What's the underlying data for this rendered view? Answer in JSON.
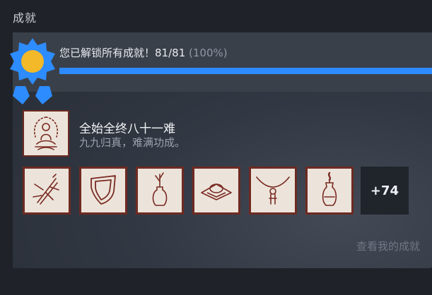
{
  "section": {
    "title": "成就"
  },
  "summary": {
    "message": "您已解锁所有成就！",
    "count": "81/81",
    "percent": "(100%)",
    "progress": 1.0,
    "progress_color": "#2e8bff"
  },
  "featured": {
    "title": "全始全终八十一难",
    "description": "九九归真，难满功成。",
    "icon": "monk-meditating-icon"
  },
  "achievement_icons": [
    "staff-burst-icon",
    "shield-icon",
    "vase-with-branch-icon",
    "ring-necklace-icon",
    "pendant-necklace-icon",
    "vase-with-flame-icon"
  ],
  "more": {
    "label": "+74"
  },
  "view_link": {
    "label": "查看我的成就"
  },
  "colors": {
    "icon_bg": "#ece4da",
    "icon_ink": "#7a2a22",
    "accent": "#2e8bff"
  }
}
